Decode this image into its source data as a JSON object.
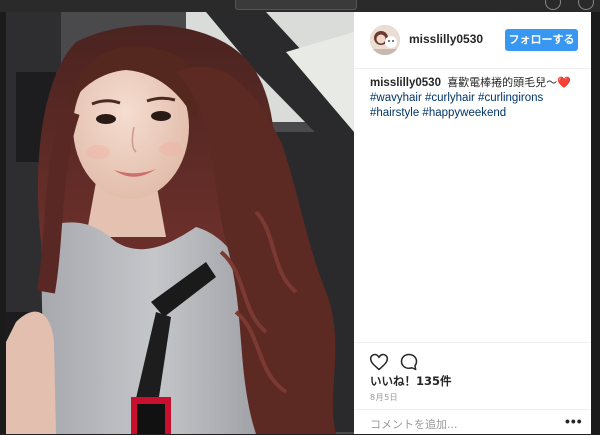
{
  "post": {
    "username": "misslilly0530",
    "follow_label": "フォローする",
    "caption": {
      "username": "misslilly0530",
      "text": "喜歡電棒捲的頭毛兒〜",
      "emoji": "❤️",
      "hashtags": [
        "#wavyhair",
        "#curlyhair",
        "#curlingirons",
        "#hairstyle",
        "#happyweekend"
      ]
    },
    "actions": {
      "like_icon": "heart-outline-icon",
      "comment_icon": "comment-bubble-icon"
    },
    "likes": "いいね！135件",
    "date": "8月5日",
    "comment": {
      "placeholder": "コメントを追加...",
      "more_label": "•••"
    }
  },
  "colors": {
    "follow_button": "#3897f0",
    "hashtag": "#003569",
    "secondary_text": "#999999",
    "divider": "#efefef"
  }
}
